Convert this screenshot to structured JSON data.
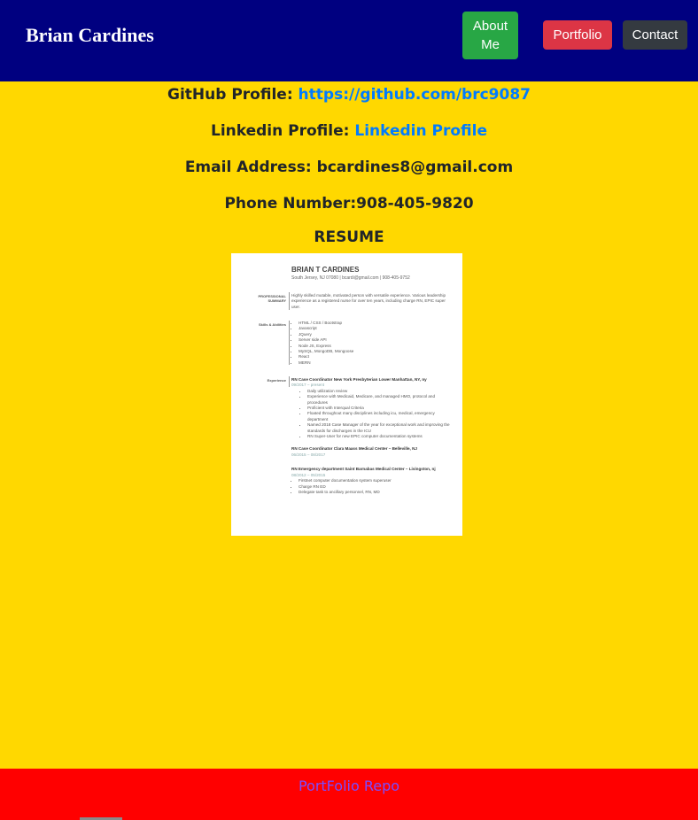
{
  "nav": {
    "brand": "Brian Cardines",
    "about_label": "About Me",
    "portfolio_label": "Portfolio",
    "contact_label": "Contact"
  },
  "contact": {
    "github_label": "GitHub Profile:",
    "github_link": "https://github.com/brc9087",
    "linkedin_label": "Linkedin Profile:",
    "linkedin_link": "Linkedin Profile",
    "email_label": "Email Address:",
    "email_value": "bcardines8@gmail.com",
    "phone_label": "Phone Number:",
    "phone_value": "908-405-9820",
    "resume_heading": "RESUME"
  },
  "resume": {
    "name": "BRIAN T CARDINES",
    "contact_line": "South Jersey, NJ 07080 | bcardi@gmail.com | 908-405-9752",
    "summary_title": "PROFESSIONAL SUMMARY",
    "summary_text": "Highly skilled mutable, motivated person with versatile experience. Various leadership experience as a registered nurse for over ten years, including charge RN, EPIC super user.",
    "skills_title": "Skills & Abilities",
    "skills": [
      "HTML / CSS / Bootstrap",
      "Javascript",
      "JQuery",
      "Server side API",
      "Node JS, Express",
      "MySQL, MongoDB, Mongoose",
      "React",
      "MERN"
    ],
    "experience_title": "Experience",
    "job1_title": "RN Case Coordinator New York Presbyterian Lower Manhattan, NY, ny",
    "job1_date": "09/2017 – present",
    "job1_items": [
      "Daily utilization review",
      "Experience with Medicaid, Medicare, and managed HMO, protocol and procedures",
      "Proficient with Interqual Criteria",
      "Floated throughout many disciplines including icu, medical, emergency department",
      "Named 2018 Case Manager of the year for exceptional work and improving the standards for discharges in the ICU",
      "RN Super-User for new EPIC computer documentation systems"
    ],
    "job2_title": "RN Case Coordinator Clara Maass Medical Center – Belleville, NJ",
    "job2_date": "06/2015 – 08/2017",
    "job3_title": "RN Emergency department Saint Barnabas Medical Center – Livingston, nj",
    "job3_date": "08/2012 – 05/2015",
    "job3_items": [
      "Firstnet computer documentation system superuser",
      "Charge RN ED",
      "Delegate task to ancillary personnel, RN, MD"
    ]
  },
  "footer": {
    "repo_link": "PortFolio Repo"
  }
}
